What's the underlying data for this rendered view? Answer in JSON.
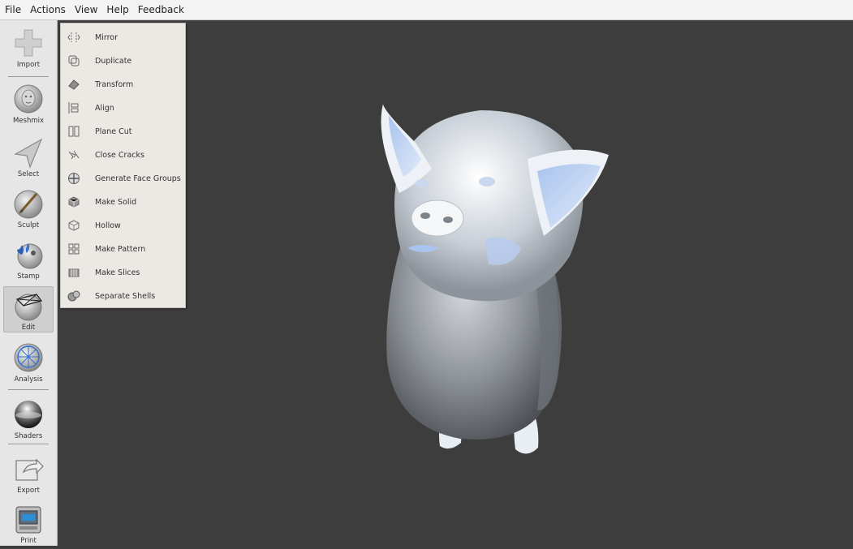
{
  "menubar": {
    "items": [
      "File",
      "Actions",
      "View",
      "Help",
      "Feedback"
    ]
  },
  "toolbar": {
    "tools": [
      {
        "label": "Import",
        "icon": "plus-icon"
      },
      {
        "label": "Meshmix",
        "icon": "meshmix-face-icon"
      },
      {
        "label": "Select",
        "icon": "select-arrow-icon"
      },
      {
        "label": "Sculpt",
        "icon": "sculpt-brush-icon"
      },
      {
        "label": "Stamp",
        "icon": "stamp-icon"
      },
      {
        "label": "Edit",
        "icon": "edit-icon",
        "active": true
      },
      {
        "label": "Analysis",
        "icon": "analysis-icon"
      },
      {
        "label": "Shaders",
        "icon": "shader-sphere-icon"
      },
      {
        "label": "Export",
        "icon": "export-icon"
      },
      {
        "label": "Print",
        "icon": "printer-icon"
      }
    ]
  },
  "edit_menu": {
    "items": [
      {
        "label": "Mirror",
        "icon": "mirror-icon"
      },
      {
        "label": "Duplicate",
        "icon": "duplicate-icon"
      },
      {
        "label": "Transform",
        "icon": "transform-icon"
      },
      {
        "label": "Align",
        "icon": "align-icon"
      },
      {
        "label": "Plane Cut",
        "icon": "plane-cut-icon"
      },
      {
        "label": "Close Cracks",
        "icon": "close-cracks-icon"
      },
      {
        "label": "Generate Face Groups",
        "icon": "face-groups-icon"
      },
      {
        "label": "Make Solid",
        "icon": "make-solid-icon"
      },
      {
        "label": "Hollow",
        "icon": "hollow-icon"
      },
      {
        "label": "Make Pattern",
        "icon": "make-pattern-icon"
      },
      {
        "label": "Make Slices",
        "icon": "make-slices-icon"
      },
      {
        "label": "Separate Shells",
        "icon": "separate-shells-icon"
      }
    ]
  },
  "viewport": {
    "background": "#3d3d3d",
    "model": "pig-model"
  }
}
